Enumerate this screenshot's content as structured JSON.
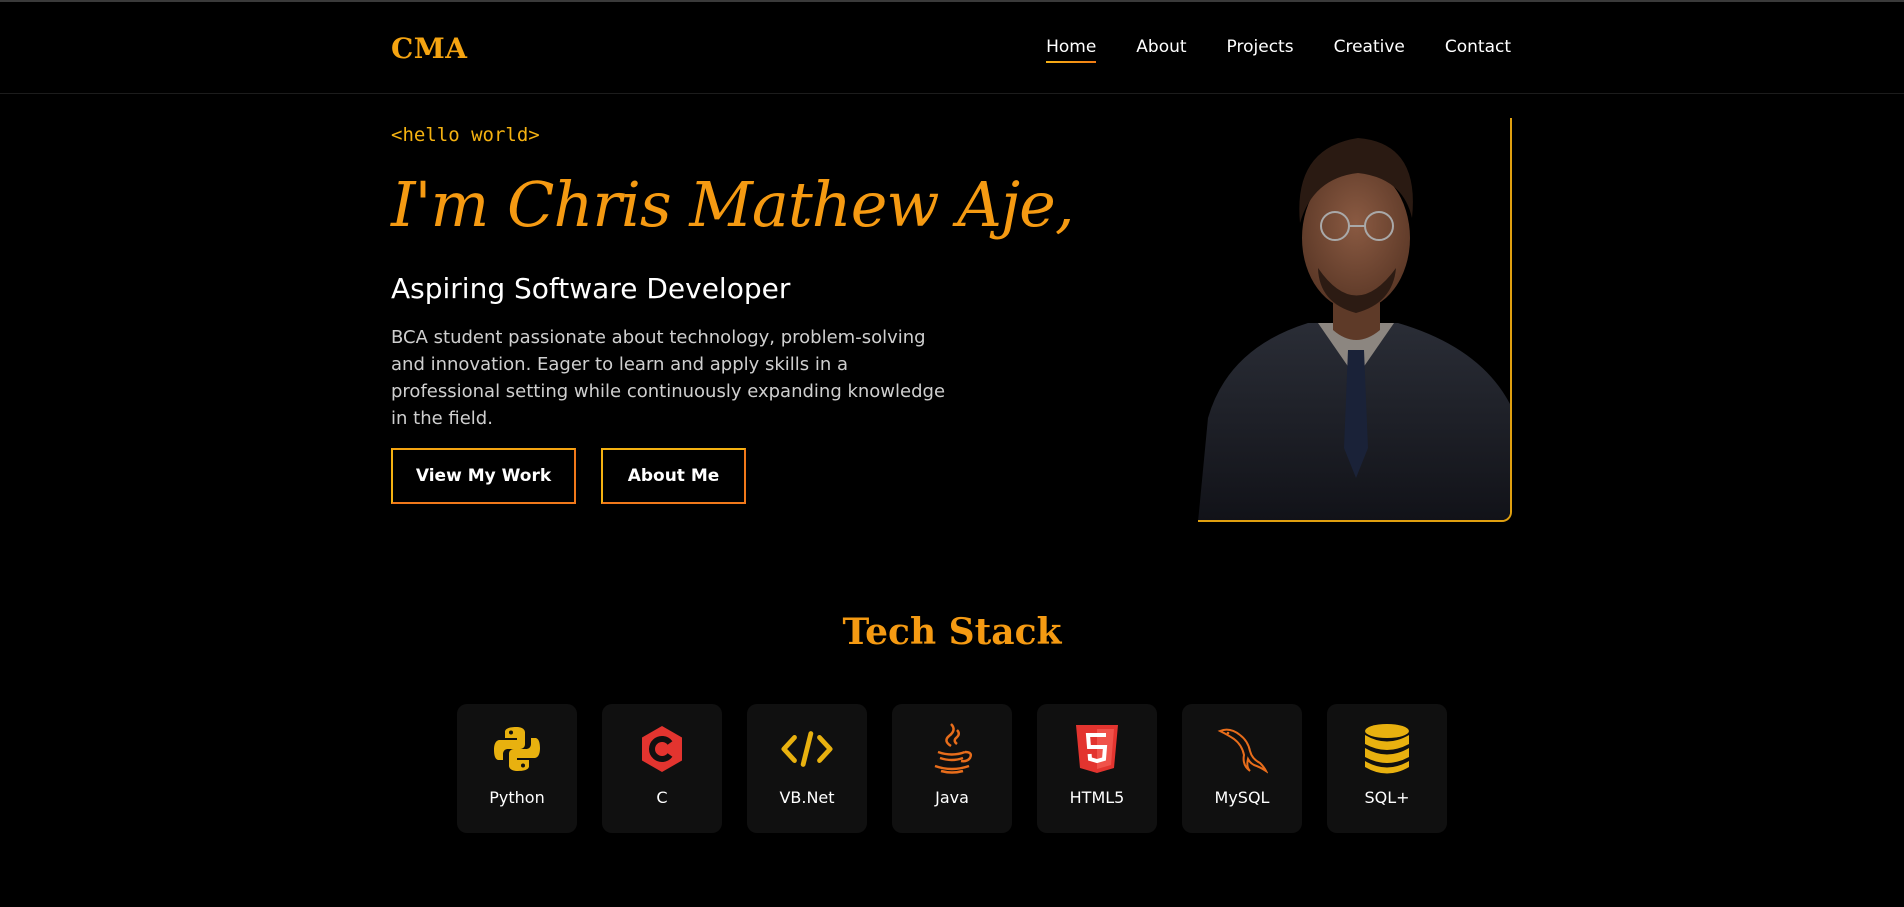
{
  "brand": {
    "logo": "CMA"
  },
  "nav": [
    {
      "label": "Home",
      "active": true
    },
    {
      "label": "About"
    },
    {
      "label": "Projects"
    },
    {
      "label": "Creative"
    },
    {
      "label": "Contact"
    }
  ],
  "hero": {
    "eyebrow": "<hello world>",
    "name": "I'm Chris Mathew Aje,",
    "role": "Aspiring Software Developer",
    "bio": "BCA student passionate about technology, problem-solving and innovation. Eager to learn and apply skills in a professional setting while continuously expanding knowledge in the field.",
    "primary_button": "View My Work",
    "secondary_button": "About Me"
  },
  "tech_stack": {
    "title": "Tech Stack",
    "items": [
      {
        "label": "Python",
        "icon": "python-icon"
      },
      {
        "label": "C",
        "icon": "c-icon"
      },
      {
        "label": "VB.Net",
        "icon": "code-icon"
      },
      {
        "label": "Java",
        "icon": "java-icon"
      },
      {
        "label": "HTML5",
        "icon": "html5-icon"
      },
      {
        "label": "MySQL",
        "icon": "mysql-icon"
      },
      {
        "label": "SQL+",
        "icon": "database-icon"
      }
    ]
  },
  "colors": {
    "accent": "#f59a12",
    "accent_light": "#f5b211",
    "accent_dark": "#f0781a",
    "card_bg": "#101010",
    "html5": "#e3342f"
  }
}
